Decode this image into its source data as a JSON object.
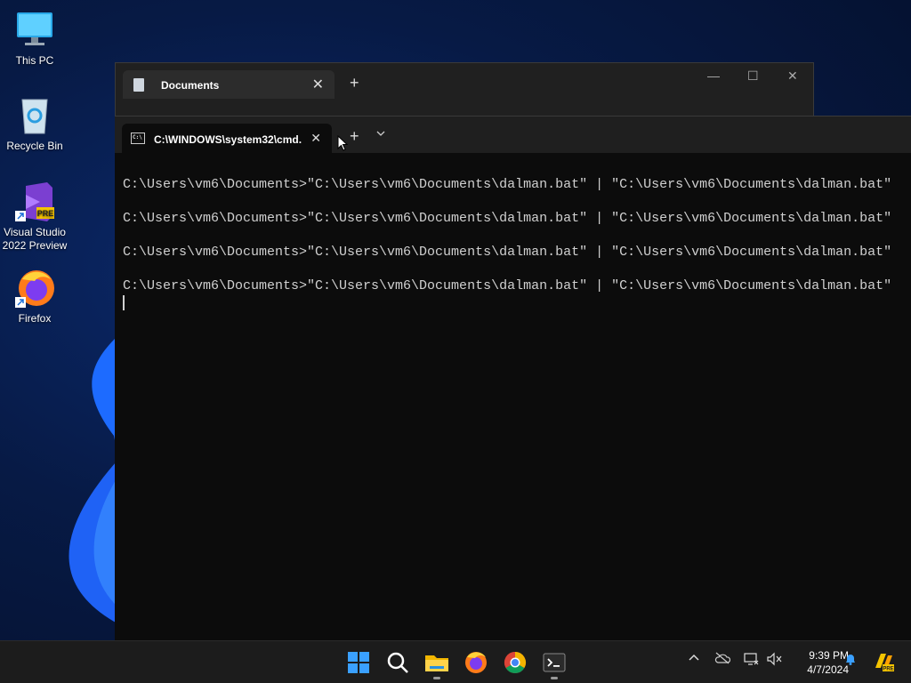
{
  "desktop": {
    "icons": [
      {
        "label": "This PC"
      },
      {
        "label": "Recycle Bin"
      },
      {
        "label": "Visual Studio 2022 Preview",
        "badge": "PRE"
      },
      {
        "label": "Firefox"
      }
    ]
  },
  "explorer": {
    "tab_title": "Documents",
    "new_tab": "+",
    "minimize": "—",
    "maximize": "☐",
    "close": "✕"
  },
  "terminal": {
    "tab_title": "C:\\WINDOWS\\system32\\cmd.",
    "new_tab": "+",
    "dropdown": "⌄",
    "lines": [
      "C:\\Users\\vm6\\Documents>\"C:\\Users\\vm6\\Documents\\dalman.bat\" | \"C:\\Users\\vm6\\Documents\\dalman.bat\"",
      "C:\\Users\\vm6\\Documents>\"C:\\Users\\vm6\\Documents\\dalman.bat\" | \"C:\\Users\\vm6\\Documents\\dalman.bat\"",
      "C:\\Users\\vm6\\Documents>\"C:\\Users\\vm6\\Documents\\dalman.bat\" | \"C:\\Users\\vm6\\Documents\\dalman.bat\"",
      "C:\\Users\\vm6\\Documents>\"C:\\Users\\vm6\\Documents\\dalman.bat\" | \"C:\\Users\\vm6\\Documents\\dalman.bat\""
    ]
  },
  "taskbar": {
    "apps": [
      "start-icon",
      "search-icon",
      "file-explorer-icon",
      "firefox-icon",
      "chrome-icon",
      "terminal-icon"
    ],
    "time": "9:39 PM",
    "date": "4/7/2024",
    "tray_chevron": "^",
    "colors": {
      "taskbar_bg": "#1c1c1c",
      "start_blue": "#3aa0ff"
    }
  }
}
